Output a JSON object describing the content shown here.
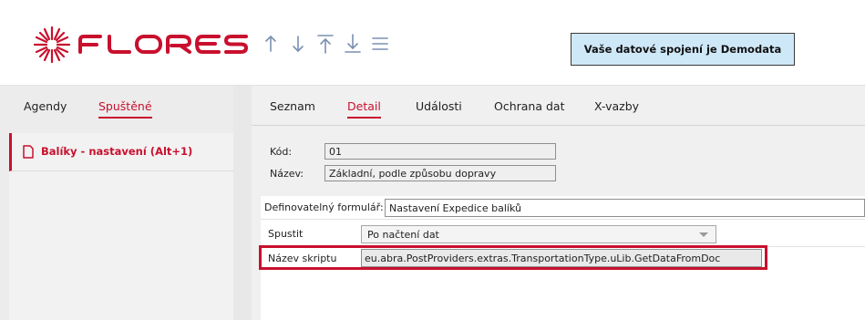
{
  "header": {
    "logo_text": "FLORES",
    "connection_text": "Vaše datové spojení je Demodata",
    "brand_color": "#c8102e",
    "nav_icons": [
      "arrow-up-icon",
      "arrow-down-icon",
      "arrow-first-icon",
      "arrow-last-icon",
      "hamburger-menu-icon"
    ]
  },
  "sidebar": {
    "tabs": [
      {
        "label": "Agendy"
      },
      {
        "label": "Spuštěné"
      }
    ],
    "items": [
      {
        "label": "Balíky - nastavení (Alt+1)",
        "icon": "document-icon"
      }
    ]
  },
  "main": {
    "tabs": [
      {
        "label": "Seznam"
      },
      {
        "label": "Detail"
      },
      {
        "label": "Události"
      },
      {
        "label": "Ochrana dat"
      },
      {
        "label": "X-vazby"
      }
    ],
    "fields": {
      "kod_label": "Kód:",
      "kod_value": "01",
      "nazev_label": "Název:",
      "nazev_value": "Základní, podle způsobu dopravy",
      "formular_label": "Definovatelný formulář:",
      "formular_value": "Nastavení Expedice balíků",
      "spustit_label": "Spustit",
      "spustit_value": "Po načtení dat",
      "skript_label": "Název skriptu",
      "skript_value": "eu.abra.PostProviders.extras.TransportationType.uLib.GetDataFromDoc"
    }
  }
}
